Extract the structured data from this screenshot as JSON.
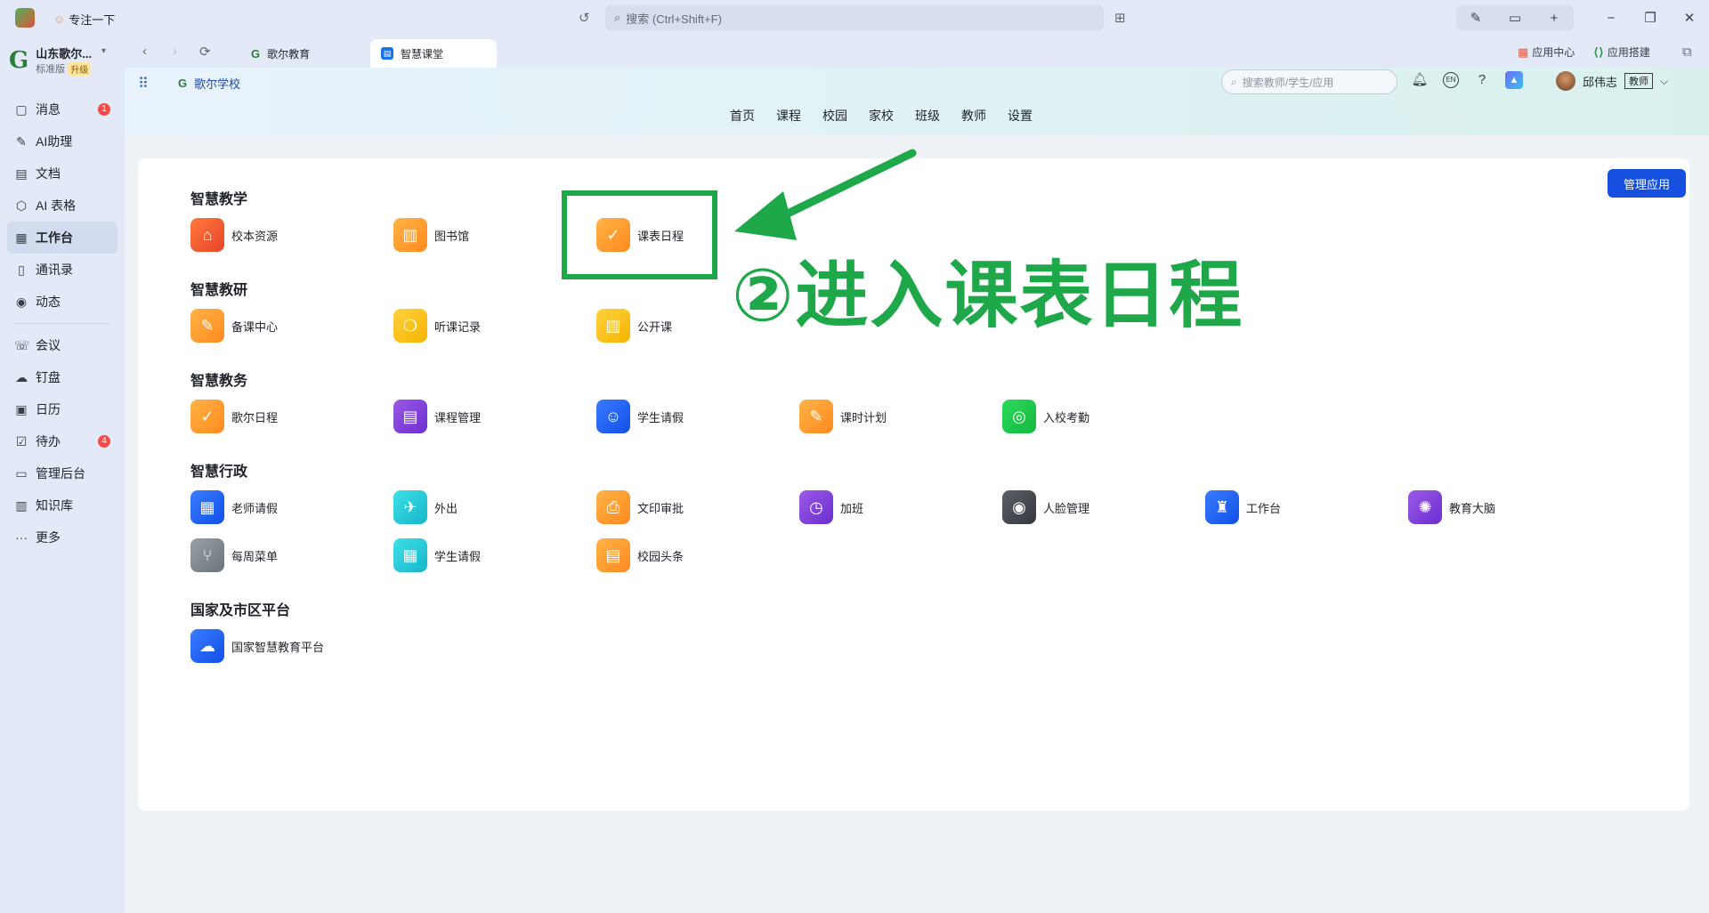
{
  "titlebar": {
    "focus_label": "专注一下",
    "search_placeholder": "搜索 (Ctrl+Shift+F)"
  },
  "org": {
    "name": "山东歌尔...",
    "edition": "标准版",
    "upgrade": "升级"
  },
  "sidebar": {
    "items": [
      {
        "label": "消息",
        "icon": "message-icon",
        "count": "1"
      },
      {
        "label": "AI助理",
        "icon": "ai-assistant-icon"
      },
      {
        "label": "文档",
        "icon": "document-icon"
      },
      {
        "label": "AI 表格",
        "icon": "ai-table-icon"
      },
      {
        "label": "工作台",
        "icon": "workbench-icon",
        "active": true
      },
      {
        "label": "通讯录",
        "icon": "contacts-icon"
      },
      {
        "label": "动态",
        "icon": "feed-icon"
      },
      {
        "label": "会议",
        "icon": "meeting-icon"
      },
      {
        "label": "钉盘",
        "icon": "cloud-drive-icon"
      },
      {
        "label": "日历",
        "icon": "calendar-icon"
      },
      {
        "label": "待办",
        "icon": "todo-icon",
        "count": "4"
      },
      {
        "label": "管理后台",
        "icon": "admin-icon"
      },
      {
        "label": "知识库",
        "icon": "knowledge-icon"
      },
      {
        "label": "更多",
        "icon": "more-icon"
      }
    ]
  },
  "tabs": [
    {
      "label": "歌尔教育"
    },
    {
      "label": "智慧课堂"
    }
  ],
  "tab_links": {
    "app_center": "应用中心",
    "app_builder": "应用搭建"
  },
  "header": {
    "school": "歌尔学校",
    "search_placeholder": "搜索教师/学生/应用",
    "en_label": "EN",
    "user_name": "邱伟志",
    "user_role": "教师",
    "nav": [
      "首页",
      "课程",
      "校园",
      "家校",
      "班级",
      "教师",
      "设置"
    ]
  },
  "main": {
    "manage_button": "管理应用",
    "sections": [
      {
        "title": "智慧教学",
        "apps": [
          "校本资源",
          "图书馆",
          "课表日程"
        ]
      },
      {
        "title": "智慧教研",
        "apps": [
          "备课中心",
          "听课记录",
          "公开课"
        ]
      },
      {
        "title": "智慧教务",
        "apps": [
          "歌尔日程",
          "课程管理",
          "学生请假",
          "课时计划",
          "入校考勤"
        ]
      },
      {
        "title": "智慧行政",
        "apps": [
          "老师请假",
          "外出",
          "文印审批",
          "加班",
          "人脸管理",
          "工作台",
          "教育大脑",
          "每周菜单",
          "学生请假",
          "校园头条"
        ]
      },
      {
        "title": "国家及市区平台",
        "apps": [
          "国家智慧教育平台"
        ]
      }
    ]
  },
  "annotation": {
    "text": "②进入课表日程",
    "color": "#1fa84a"
  },
  "colors": {
    "accent": "#1550e0",
    "badge": "#f54a45"
  }
}
